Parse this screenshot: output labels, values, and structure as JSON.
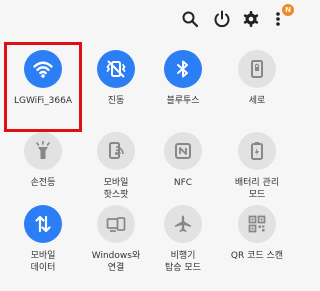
{
  "topbar": {
    "icons": [
      "search-icon",
      "power-icon",
      "settings-icon",
      "more-icon"
    ],
    "notification_badge": "N"
  },
  "tiles": [
    {
      "label": "LGWiFi_366A",
      "icon": "wifi-icon",
      "active": true
    },
    {
      "label": "진동",
      "icon": "vibrate-icon",
      "active": true
    },
    {
      "label": "블루투스",
      "icon": "bluetooth-icon",
      "active": true
    },
    {
      "label": "세로",
      "icon": "portrait-lock-icon",
      "active": false
    },
    {
      "label": "손전등",
      "icon": "flashlight-icon",
      "active": false
    },
    {
      "label": "모바일\n핫스팟",
      "icon": "hotspot-icon",
      "active": false
    },
    {
      "label": "NFC",
      "icon": "nfc-icon",
      "active": false
    },
    {
      "label": "배터리 관리\n모드",
      "icon": "battery-saver-icon",
      "active": false
    },
    {
      "label": "모바일\n데이터",
      "icon": "mobile-data-icon",
      "active": true
    },
    {
      "label": "Windows와\n연결",
      "icon": "link-to-windows-icon",
      "active": false
    },
    {
      "label": "비행기\n탑승 모드",
      "icon": "airplane-icon",
      "active": false
    },
    {
      "label": "QR 코드 스캔",
      "icon": "qr-code-icon",
      "active": false
    }
  ],
  "colors": {
    "active": "#2b7ef4",
    "inactive": "#e2e2e2",
    "highlight": "#e10f0f"
  }
}
